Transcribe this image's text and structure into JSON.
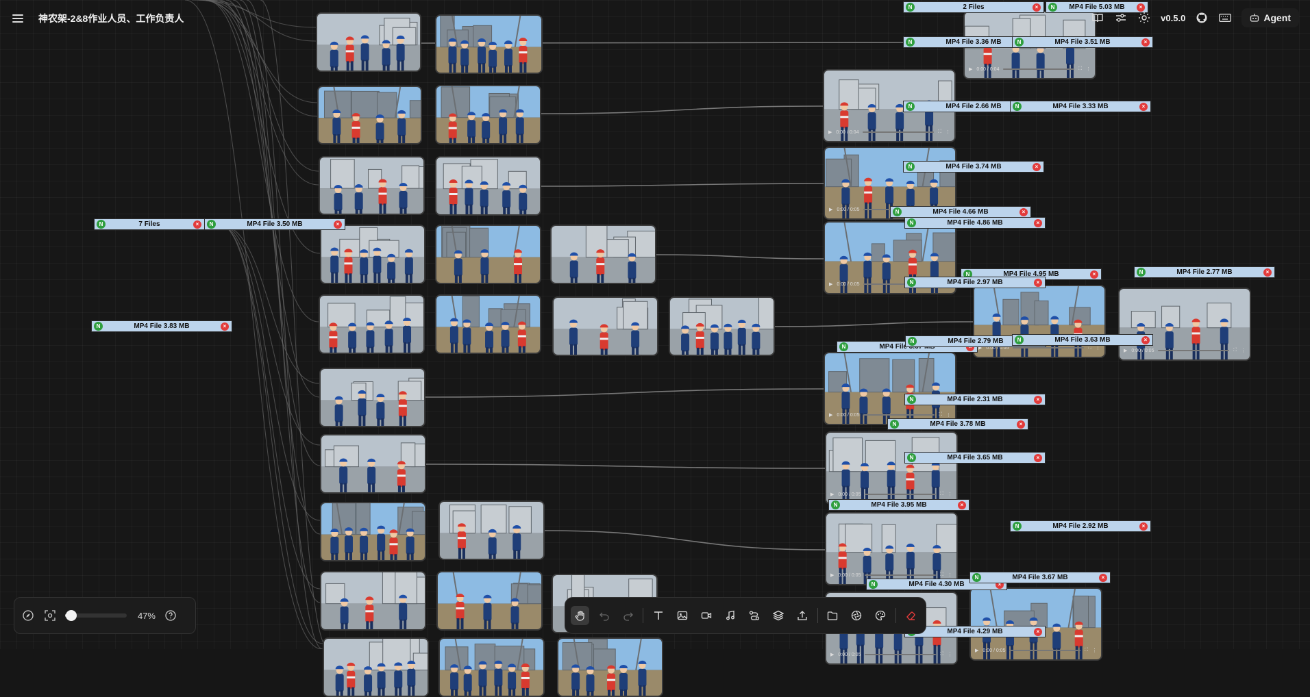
{
  "app": {
    "title": "神农架-2&8作业人员、工作负责人",
    "version": "v0.5.0",
    "agent_label": "Agent"
  },
  "zoom": {
    "percent_label": "47%",
    "value": 0.47
  },
  "toolbar": {
    "tools": [
      {
        "name": "hand-tool",
        "icon": "hand-icon",
        "active": true
      },
      {
        "name": "undo-button",
        "icon": "undo-icon",
        "disabled": true
      },
      {
        "name": "redo-button",
        "icon": "redo-icon",
        "disabled": true
      },
      {
        "name": "text-tool",
        "icon": "text-icon"
      },
      {
        "name": "image-tool",
        "icon": "image-icon"
      },
      {
        "name": "video-tool",
        "icon": "video-icon"
      },
      {
        "name": "audio-tool",
        "icon": "music-note-icon"
      },
      {
        "name": "connect-tool",
        "icon": "nodes-icon"
      },
      {
        "name": "layers-tool",
        "icon": "layers-icon"
      },
      {
        "name": "export-tool",
        "icon": "upload-icon"
      },
      {
        "name": "open-folder-tool",
        "icon": "folder-icon"
      },
      {
        "name": "model-tool",
        "icon": "aperture-icon"
      },
      {
        "name": "palette-tool",
        "icon": "palette-icon"
      },
      {
        "name": "eraser-tool",
        "icon": "eraser-icon",
        "accent": "#e23b3b"
      }
    ]
  },
  "video_time_labels": [
    "0:00 / 0:04",
    "0:00 / 0:05"
  ],
  "file_tags": [
    "2 Files",
    "MP4 File 5.03 MB",
    "MP4 File 3.36 MB",
    "MP4 File 3.51 MB",
    "MP4 File 2.66 MB",
    "MP4 File 3.33 MB",
    "MP4 File 3.74 MB",
    "7 Files",
    "MP4 File 3.50 MB",
    "MP4 File 4.66 MB",
    "MP4 File 4.86 MB",
    "MP4 File 4.95 MB",
    "MP4 File 2.77 MB",
    "MP4 File 2.97 MB",
    "MP4 File 3.83 MB",
    "MP4 File 3.67 MB",
    "MP4 File 2.79 MB",
    "MP4 File 3.63 MB",
    "MP4 File 2.31 MB",
    "MP4 File 3.78 MB",
    "MP4 File 3.65 MB",
    "MP4 File 3.95 MB",
    "MP4 File 2.92 MB",
    "MP4 File 4.30 MB",
    "MP4 File 3.67 MB",
    "MP4 File 4.29 MB"
  ],
  "colors": {
    "accent_red": "#e23b3b",
    "tag_bg": "#bcd4ec",
    "file_icon_green": "#2e9e3e"
  }
}
